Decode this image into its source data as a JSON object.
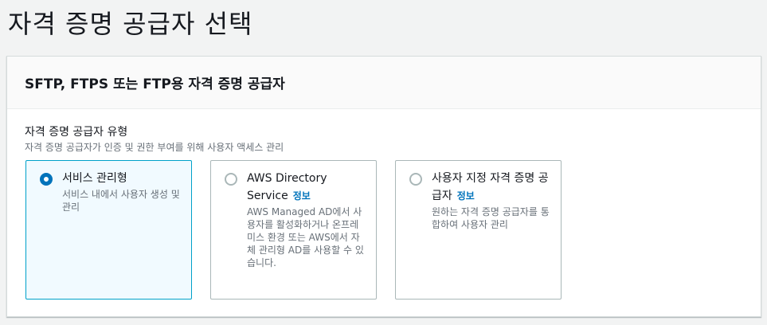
{
  "page": {
    "title": "자격 증명 공급자 선택"
  },
  "panel": {
    "title": "SFTP, FTPS 또는 FTP용 자격 증명 공급자",
    "field": {
      "label": "자격 증명 공급자 유형",
      "description": "자격 증명 공급자가 인증 및 권한 부여를 위해 사용자 액세스 관리"
    },
    "options": [
      {
        "title": "서비스 관리형",
        "description": "서비스 내에서 사용자 생성 및 관리",
        "selected": true
      },
      {
        "title": "AWS Directory Service",
        "info": "정보",
        "description": "AWS Managed AD에서 사용자를 활성화하거나 온프레미스 환경 또는 AWS에서 자체 관리형 AD를 사용할 수 있습니다.",
        "selected": false
      },
      {
        "title": "사용자 지정 자격 증명 공급자",
        "info": "정보",
        "description": "원하는 자격 증명 공급자를 통합하여 사용자 관리",
        "selected": false
      }
    ]
  },
  "colors": {
    "accent": "#0073bb",
    "selected_border": "#00a1c9",
    "selected_bg": "#f1faff"
  }
}
